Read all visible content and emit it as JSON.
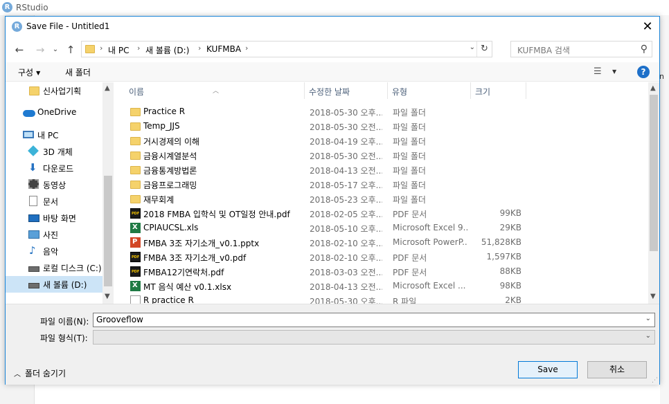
{
  "app": {
    "title": "RStudio",
    "right_edge_text": "n"
  },
  "dialog": {
    "title": "Save File - Untitled1"
  },
  "address": {
    "crumbs": [
      "내 PC",
      "새 볼륨 (D:)",
      "KUFMBA"
    ]
  },
  "search": {
    "placeholder": "KUFMBA 검색"
  },
  "toolbar": {
    "organize_label": "구성",
    "new_folder_label": "새 폴더"
  },
  "nav": {
    "items": [
      {
        "label": "신사업기획",
        "icon": "folder-icon"
      },
      {
        "label": "OneDrive",
        "icon": "onedrive-icon"
      },
      {
        "label": "내 PC",
        "icon": "pc-icon"
      },
      {
        "label": "3D 개체",
        "icon": "3d-objects-icon"
      },
      {
        "label": "다운로드",
        "icon": "download-icon"
      },
      {
        "label": "동영상",
        "icon": "video-icon"
      },
      {
        "label": "문서",
        "icon": "documents-icon"
      },
      {
        "label": "바탕 화면",
        "icon": "desktop-icon"
      },
      {
        "label": "사진",
        "icon": "pictures-icon"
      },
      {
        "label": "음악",
        "icon": "music-icon"
      },
      {
        "label": "로컬 디스크 (C:)",
        "icon": "drive-icon"
      },
      {
        "label": "새 볼륨 (D:)",
        "icon": "drive-icon",
        "selected": true
      }
    ]
  },
  "columns": {
    "name": "이름",
    "date": "수정한 날짜",
    "type": "유형",
    "size": "크기"
  },
  "files": [
    {
      "name": "Practice R",
      "date": "2018-05-30 오후...",
      "type": "파일 폴더",
      "size": "",
      "kind": "folder"
    },
    {
      "name": "Temp_JJS",
      "date": "2018-05-30 오전...",
      "type": "파일 폴더",
      "size": "",
      "kind": "folder"
    },
    {
      "name": "거시경제의 이해",
      "date": "2018-04-19 오후...",
      "type": "파일 폴더",
      "size": "",
      "kind": "folder"
    },
    {
      "name": "금융시계열분석",
      "date": "2018-05-30 오전...",
      "type": "파일 폴더",
      "size": "",
      "kind": "folder"
    },
    {
      "name": "금융통계방법론",
      "date": "2018-04-13 오전...",
      "type": "파일 폴더",
      "size": "",
      "kind": "folder"
    },
    {
      "name": "금융프로그래밍",
      "date": "2018-05-17 오후...",
      "type": "파일 폴더",
      "size": "",
      "kind": "folder"
    },
    {
      "name": "재무회계",
      "date": "2018-05-23 오후...",
      "type": "파일 폴더",
      "size": "",
      "kind": "folder"
    },
    {
      "name": "2018 FMBA 입학식 및 OT일정 안내.pdf",
      "date": "2018-02-05 오후...",
      "type": "PDF 문서",
      "size": "99KB",
      "kind": "pdf"
    },
    {
      "name": "CPIAUCSL.xls",
      "date": "2018-05-10 오후...",
      "type": "Microsoft Excel 9...",
      "size": "29KB",
      "kind": "xls"
    },
    {
      "name": "FMBA 3조 자기소개_v0.1.pptx",
      "date": "2018-02-10 오후...",
      "type": "Microsoft PowerP...",
      "size": "51,828KB",
      "kind": "ppt"
    },
    {
      "name": "FMBA 3조 자기소개_v0.pdf",
      "date": "2018-02-10 오후...",
      "type": "PDF 문서",
      "size": "1,597KB",
      "kind": "pdf"
    },
    {
      "name": "FMBA12기연락처.pdf",
      "date": "2018-03-03 오전...",
      "type": "PDF 문서",
      "size": "88KB",
      "kind": "pdf"
    },
    {
      "name": "MT 음식 예산 v0.1.xlsx",
      "date": "2018-04-13 오전...",
      "type": "Microsoft Excel ...",
      "size": "98KB",
      "kind": "xls"
    },
    {
      "name": "R practice R",
      "date": "2018-05-30 오후...",
      "type": "R 파일",
      "size": "2KB",
      "kind": "r"
    }
  ],
  "form": {
    "filename_label": "파일 이름(N):",
    "filename_value": "Grooveflow",
    "filetype_label": "파일 형식(T):",
    "filetype_value": ""
  },
  "footer": {
    "hide_folders_label": "폴더 숨기기",
    "save_label": "Save",
    "cancel_label": "취소"
  }
}
